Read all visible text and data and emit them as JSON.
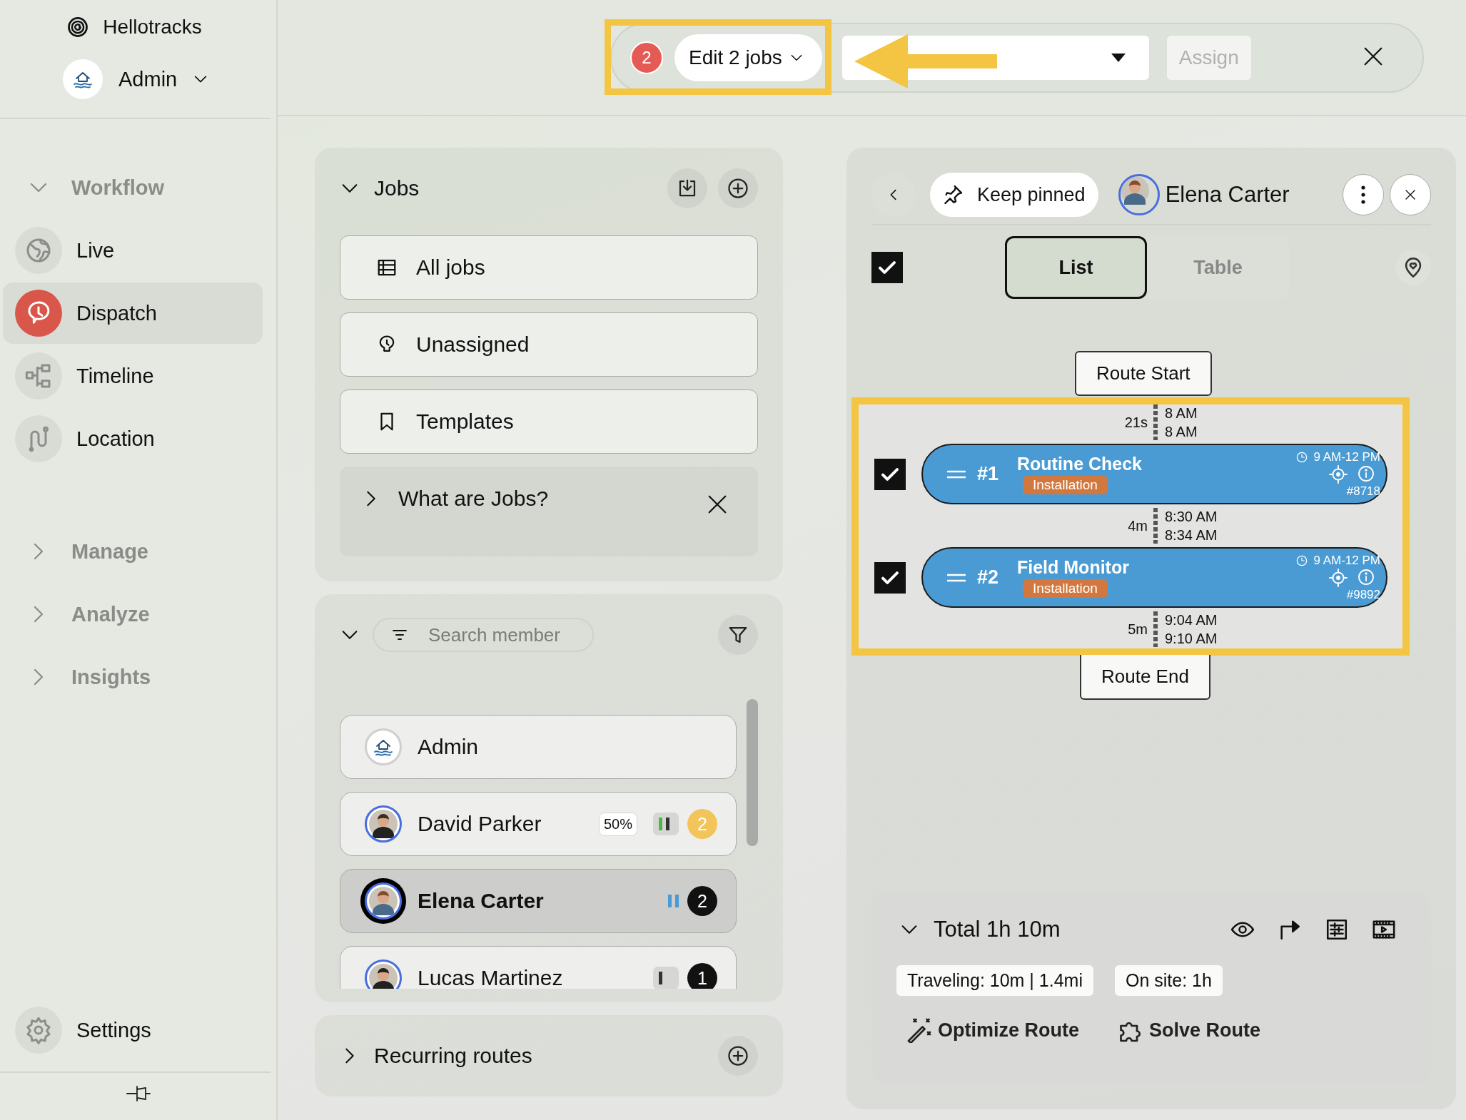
{
  "app": {
    "name": "Hellotracks",
    "account": "Admin"
  },
  "sidebar": {
    "groups": [
      {
        "label": "Workflow",
        "expanded": true,
        "items": [
          {
            "label": "Live",
            "selected": false
          },
          {
            "label": "Dispatch",
            "selected": true
          },
          {
            "label": "Timeline",
            "selected": false
          },
          {
            "label": "Location",
            "selected": false
          }
        ]
      },
      {
        "label": "Manage",
        "expanded": false
      },
      {
        "label": "Analyze",
        "expanded": false
      },
      {
        "label": "Insights",
        "expanded": false
      }
    ],
    "settings": {
      "label": "Settings",
      "selected": false
    }
  },
  "bulk_bar": {
    "selected_count": "2",
    "edit_button": "Edit 2 jobs",
    "assign_button": {
      "label": "Assign",
      "disabled": true
    }
  },
  "jobs_panel": {
    "title": "Jobs",
    "expanded": true,
    "items": [
      {
        "label": "All jobs"
      },
      {
        "label": "Unassigned"
      },
      {
        "label": "Templates"
      }
    ],
    "info_card": {
      "title": "What are Jobs?",
      "expanded": false
    }
  },
  "members_panel": {
    "expanded": true,
    "search": {
      "placeholder": "Search member"
    },
    "members": [
      {
        "kind": "company",
        "name": "Admin",
        "selected": false
      },
      {
        "kind": "person",
        "name": "David Parker",
        "selected": false,
        "utilization": "50%",
        "status_bars": [
          {
            "color": "#4cb944"
          },
          {
            "color": "#333333"
          }
        ],
        "count": {
          "text": "2",
          "color": "#f2c45a"
        }
      },
      {
        "kind": "person",
        "name": "Elena Carter",
        "selected": true,
        "status_bars": [
          {
            "color": "#4a9bd4"
          },
          {
            "color": "#4a9bd4"
          }
        ],
        "count": {
          "text": "2",
          "color": "#111111"
        }
      },
      {
        "kind": "person",
        "name": "Lucas Martinez",
        "selected": false,
        "status_bars": [
          {
            "color": "#333333"
          }
        ],
        "count": {
          "text": "1",
          "color": "#111111"
        }
      }
    ]
  },
  "recurring_routes": {
    "title": "Recurring routes",
    "expanded": false
  },
  "route_panel": {
    "keep_pinned": "Keep pinned",
    "member": "Elena Carter",
    "select_all": {
      "checked": true
    },
    "view_tabs": [
      {
        "label": "List",
        "selected": true
      },
      {
        "label": "Table",
        "selected": false
      }
    ],
    "route_start": "Route Start",
    "route_end": "Route End",
    "legs": [
      {
        "duration": "21s",
        "depart": "8 AM",
        "arrive": "8 AM"
      },
      {
        "duration": "4m",
        "depart": "8:30 AM",
        "arrive": "8:34 AM"
      },
      {
        "duration": "5m",
        "depart": "9:04 AM",
        "arrive": "9:10 AM"
      }
    ],
    "stops": [
      {
        "checked": true,
        "number": "#1",
        "title": "Routine Check",
        "tag": "Installation",
        "window": "9 AM-12 PM",
        "id": "#8718"
      },
      {
        "checked": true,
        "number": "#2",
        "title": "Field Monitor",
        "tag": "Installation",
        "window": "9 AM-12 PM",
        "id": "#9892"
      }
    ],
    "summary": {
      "expanded": true,
      "total": "Total 1h 10m",
      "chips": [
        "Traveling: 10m | 1.4mi",
        "On site: 1h"
      ],
      "actions": [
        "Optimize Route",
        "Solve Route"
      ]
    }
  }
}
